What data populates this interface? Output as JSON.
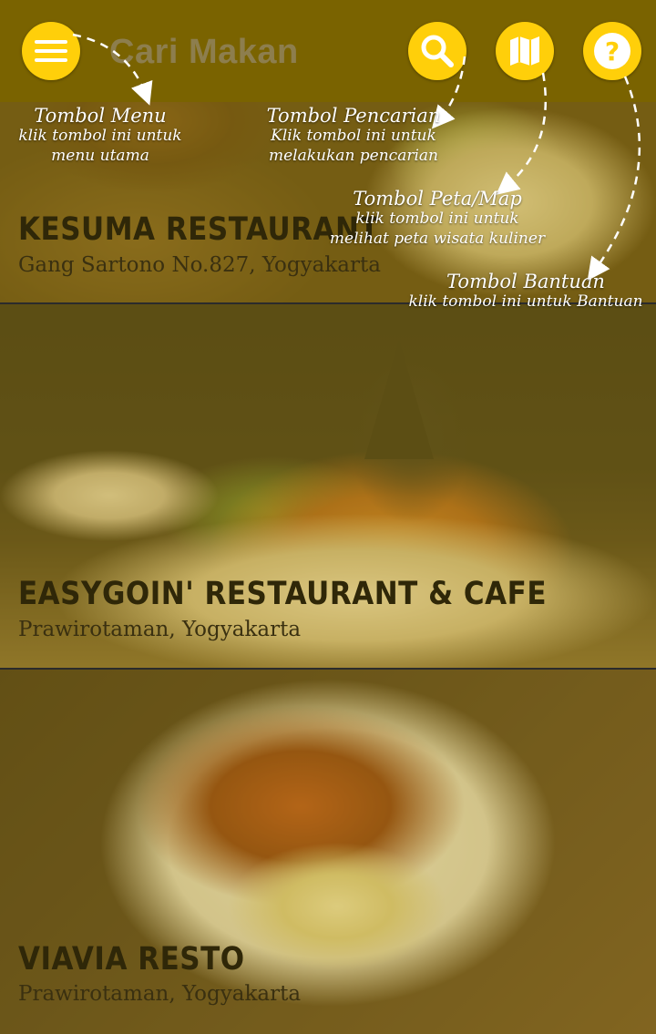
{
  "appbar": {
    "title": "Cari Makan",
    "color": "#7a6300",
    "button_color": "#ffcf0a",
    "icons": [
      "menu-icon",
      "search-icon",
      "map-icon",
      "help-icon"
    ]
  },
  "restaurants": [
    {
      "name": "KESUMA RESTAURANT",
      "address": "Gang Sartono No.827, Yogyakarta"
    },
    {
      "name": "EASYGOIN' RESTAURANT & CAFE",
      "address": "Prawirotaman, Yogyakarta"
    },
    {
      "name": "VIAVIA RESTO",
      "address": "Prawirotaman, Yogyakarta"
    }
  ],
  "tutorial": {
    "menu": {
      "title": "Tombol Menu",
      "line1": "klik tombol ini untuk",
      "line2": "menu utama"
    },
    "search": {
      "title": "Tombol Pencarian",
      "line1": "Klik tombol ini untuk",
      "line2": "melakukan pencarian"
    },
    "map": {
      "title": "Tombol Peta/Map",
      "line1": "klik tombol ini untuk",
      "line2": "melihat peta wisata kuliner"
    },
    "help": {
      "title": "Tombol Bantuan",
      "line1": "klik tombol ini untuk Bantuan"
    }
  }
}
